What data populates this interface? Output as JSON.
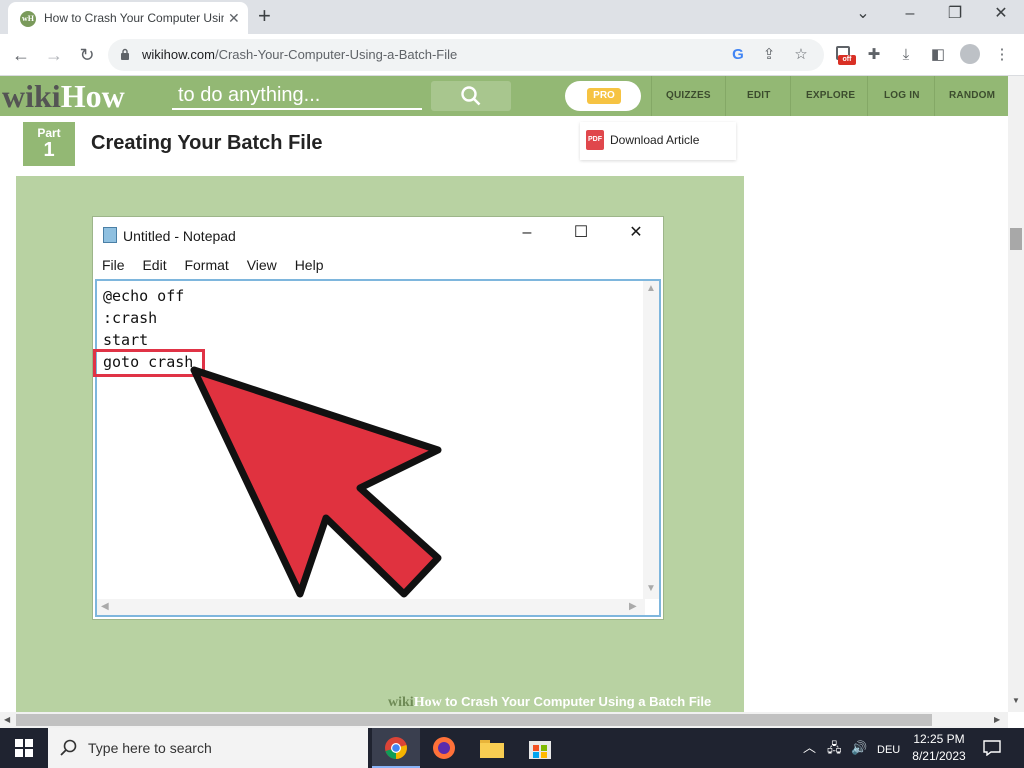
{
  "browser": {
    "tab_title": "How to Crash Your Computer Using a Batch File - wikiHow",
    "url_domain": "wikihow.com",
    "url_path": "/Crash-Your-Computer-Using-a-Batch-File",
    "extension_badge": "off"
  },
  "wikihow": {
    "logo_wiki": "wiki",
    "logo_how": "How",
    "search_placeholder": "to do anything...",
    "pro_label": "PRO",
    "nav": [
      "QUIZZES",
      "EDIT",
      "EXPLORE",
      "LOG IN",
      "RANDOM"
    ]
  },
  "article": {
    "part_label": "Part",
    "part_number": "1",
    "section_title": "Creating Your Batch File",
    "download_label": "Download Article",
    "pdf_icon_text": "PDF"
  },
  "notepad": {
    "title": "Untitled - Notepad",
    "menu": [
      "File",
      "Edit",
      "Format",
      "View",
      "Help"
    ],
    "lines": [
      "@echo off",
      ":crash",
      "start",
      "goto crash"
    ]
  },
  "watermark": {
    "wiki": "wiki",
    "how": "How",
    "caption": "to Crash Your Computer Using a Batch File"
  },
  "taskbar": {
    "search_placeholder": "Type here to search",
    "language": "DEU",
    "time": "12:25 PM",
    "date": "8/21/2023"
  },
  "colors": {
    "wikihow_green": "#93b874",
    "illustration_bg": "#b8d2a2",
    "highlight_red": "#e03346",
    "arrow_red": "#e0323f"
  }
}
